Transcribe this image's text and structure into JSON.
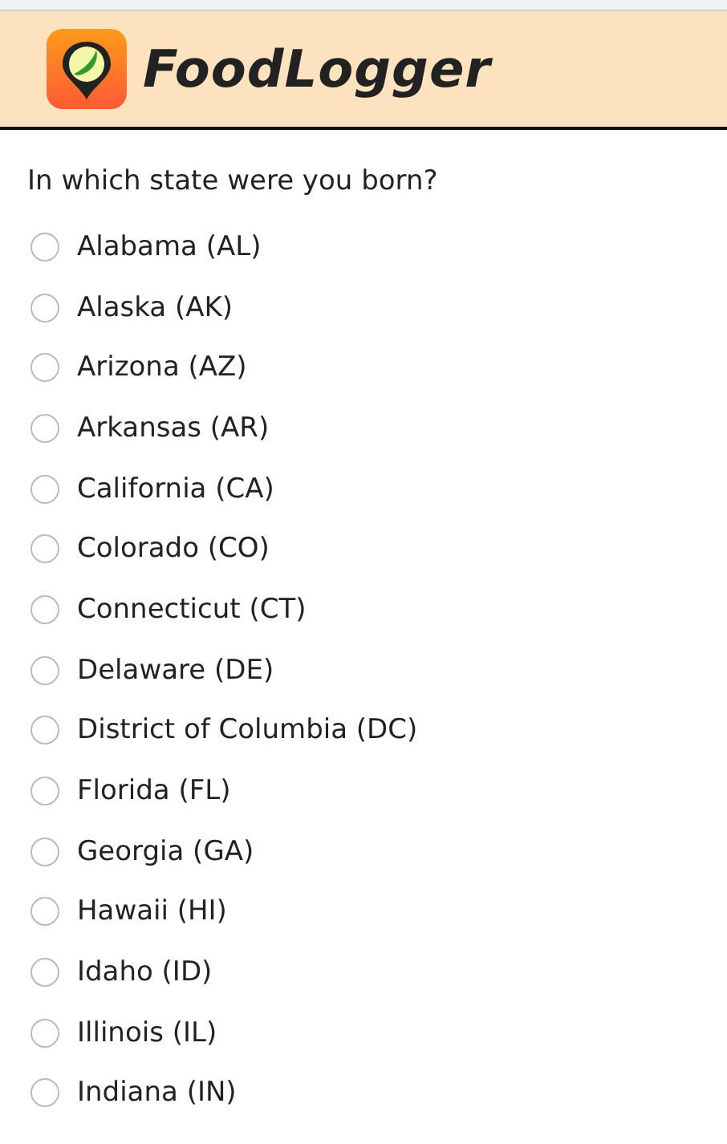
{
  "header": {
    "title": "FoodLogger"
  },
  "question": {
    "text": "In which state were you born?",
    "options": [
      {
        "label": "Alabama (AL)",
        "selected": false
      },
      {
        "label": "Alaska (AK)",
        "selected": false
      },
      {
        "label": "Arizona (AZ)",
        "selected": false
      },
      {
        "label": "Arkansas (AR)",
        "selected": false
      },
      {
        "label": "California (CA)",
        "selected": false
      },
      {
        "label": "Colorado (CO)",
        "selected": false
      },
      {
        "label": "Connecticut (CT)",
        "selected": false
      },
      {
        "label": "Delaware (DE)",
        "selected": false
      },
      {
        "label": "District of Columbia (DC)",
        "selected": false
      },
      {
        "label": "Florida (FL)",
        "selected": false
      },
      {
        "label": "Georgia (GA)",
        "selected": false
      },
      {
        "label": "Hawaii (HI)",
        "selected": false
      },
      {
        "label": "Idaho (ID)",
        "selected": false
      },
      {
        "label": "Illinois (IL)",
        "selected": false
      },
      {
        "label": "Indiana (IN)",
        "selected": false
      }
    ]
  }
}
